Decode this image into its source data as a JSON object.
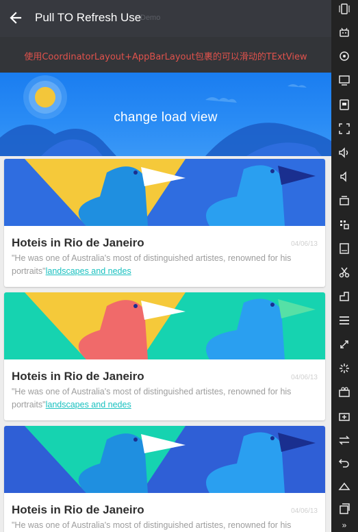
{
  "appbar": {
    "title": "Pull TO Refresh Use",
    "subtitle": "Demo",
    "back_icon": "arrow-left-icon"
  },
  "banner": {
    "text": "使用CoordinatorLayout+AppBarLayout包裹的可以滑动的TExtView"
  },
  "header": {
    "load_text": "change load view"
  },
  "cards": [
    {
      "title": "Hoteis in Rio de Janeiro",
      "date": "04/06/13",
      "body": "\"He was one of Australia's most of distinguished artistes, renowned for his portraits\"",
      "link": "landscapes and nedes",
      "palette": {
        "bg": "#2f6de0",
        "tri": "#f5c93a",
        "bird1": "#1f8fe0",
        "bird2": "#2a9ff0",
        "beak1": "#ffffff",
        "beak2": "#1a2f8f"
      }
    },
    {
      "title": "Hoteis in Rio de Janeiro",
      "date": "04/06/13",
      "body": "\"He was one of Australia's most of distinguished artistes, renowned for his portraits\"",
      "link": "landscapes and nedes",
      "palette": {
        "bg": "#16d3b0",
        "tri": "#f5c93a",
        "bird1": "#f06a6a",
        "bird2": "#2a9ff0",
        "beak1": "#ffffff",
        "beak2": "#56e0a6"
      }
    },
    {
      "title": "Hoteis in Rio de Janeiro",
      "date": "04/06/13",
      "body": "\"He was one of Australia's most of distinguished artistes, renowned for his portraits\"",
      "link": "",
      "palette": {
        "bg": "#2f5fd6",
        "tri": "#16d3b0",
        "bird1": "#1f8fe0",
        "bird2": "#2a9ff0",
        "beak1": "#ffffff",
        "beak2": "#1a2f8f"
      }
    }
  ],
  "sidebar_icons": [
    "phone-rotate-icon",
    "android-icon",
    "location-icon",
    "screen-icon",
    "device-icon",
    "fullscreen-icon",
    "volume-up-icon",
    "volume-down-icon",
    "stack-icon",
    "grid-icon",
    "apk-icon",
    "scissors-icon",
    "window-icon",
    "menu-icon",
    "resize-icon",
    "loading-icon",
    "camera-icon",
    "keyboard-icon",
    "swap-icon",
    "back-icon",
    "home-icon",
    "recent-icon",
    "expand-icon"
  ],
  "colors": {
    "appbar": "#37393f",
    "banner_text": "#e0524c",
    "link": "#19c1c0",
    "header_blue": "#1a7df0"
  }
}
